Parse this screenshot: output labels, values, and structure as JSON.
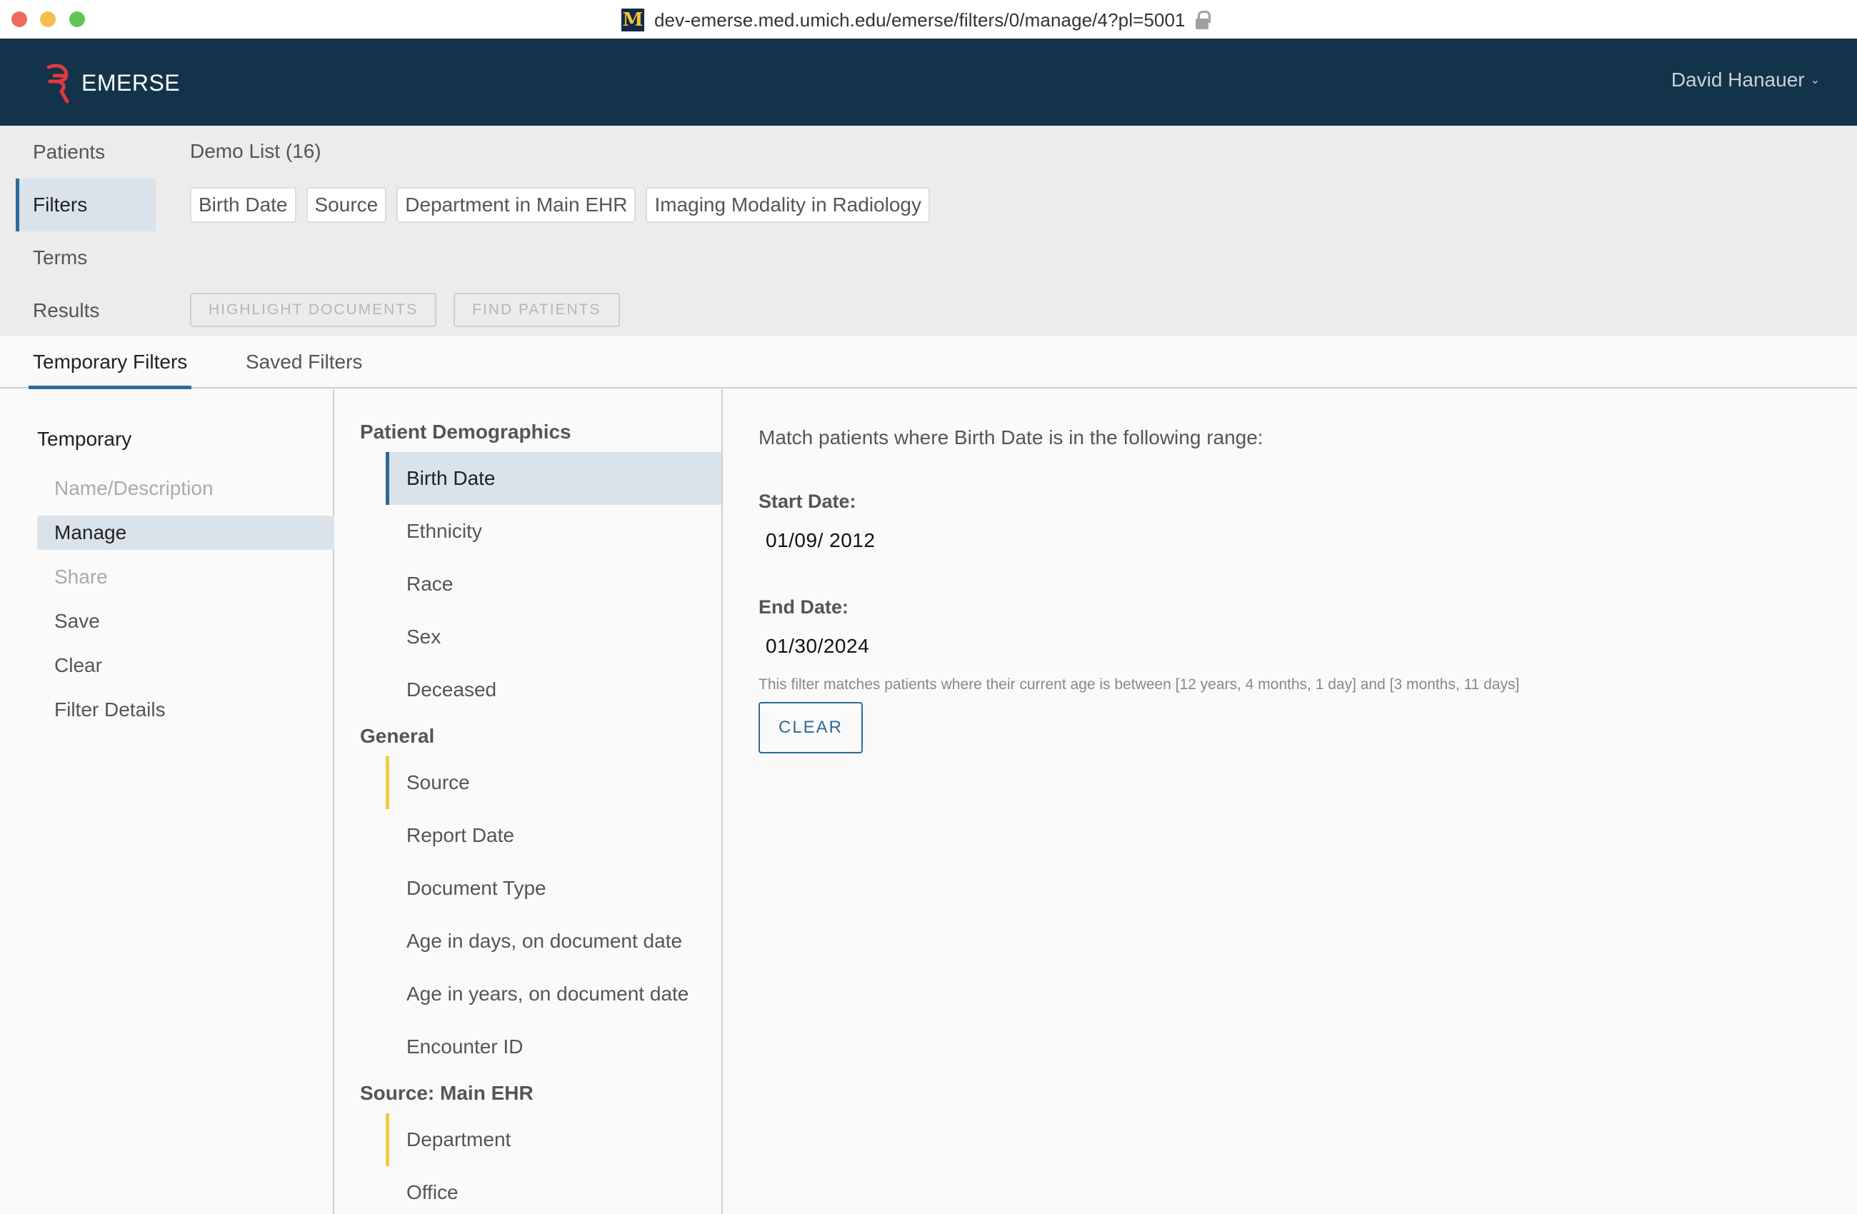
{
  "browser": {
    "url": "dev-emerse.med.umich.edu/emerse/filters/0/manage/4?pl=5001",
    "favicon_letter": "M"
  },
  "header": {
    "brand": "EMERSE",
    "user_name": "David Hanauer",
    "user_chevron": "⌄"
  },
  "main_nav": {
    "items": [
      {
        "label": "Patients"
      },
      {
        "label": "Filters",
        "active": true
      },
      {
        "label": "Terms"
      },
      {
        "label": "Results"
      }
    ]
  },
  "patient_list": {
    "label": "Demo List (16)"
  },
  "active_filters": {
    "tags": [
      "Birth Date",
      "Source",
      "Department in Main EHR",
      "Imaging Modality in Radiology"
    ]
  },
  "results_actions": {
    "highlight_label": "HIGHLIGHT DOCUMENTS",
    "find_label": "FIND PATIENTS"
  },
  "tabs": [
    {
      "label": "Temporary Filters",
      "active": true
    },
    {
      "label": "Saved Filters"
    }
  ],
  "left_nav": {
    "title": "Temporary",
    "items": [
      {
        "label": "Name/Description",
        "state": "disabled"
      },
      {
        "label": "Manage",
        "state": "active"
      },
      {
        "label": "Share",
        "state": "disabled"
      },
      {
        "label": "Save",
        "state": "normal"
      },
      {
        "label": "Clear",
        "state": "normal"
      },
      {
        "label": "Filter Details",
        "state": "normal"
      }
    ]
  },
  "filter_groups": [
    {
      "title": "Patient Demographics",
      "fields": [
        {
          "label": "Birth Date",
          "state": "active"
        },
        {
          "label": "Ethnicity",
          "state": "normal"
        },
        {
          "label": "Race",
          "state": "normal"
        },
        {
          "label": "Sex",
          "state": "normal"
        },
        {
          "label": "Deceased",
          "state": "normal"
        }
      ]
    },
    {
      "title": "General",
      "fields": [
        {
          "label": "Source",
          "state": "applied"
        },
        {
          "label": "Report Date",
          "state": "normal"
        },
        {
          "label": "Document Type",
          "state": "normal"
        },
        {
          "label": "Age in days, on document date",
          "state": "normal"
        },
        {
          "label": "Age in years, on document date",
          "state": "normal"
        },
        {
          "label": "Encounter ID",
          "state": "normal"
        }
      ]
    },
    {
      "title": "Source: Main EHR",
      "fields": [
        {
          "label": "Department",
          "state": "applied"
        },
        {
          "label": "Office",
          "state": "normal"
        }
      ]
    }
  ],
  "detail": {
    "description": "Match patients where Birth Date is in the following range:",
    "start_label": "Start Date:",
    "start_value": "01/09/ 2012",
    "end_label": "End Date:",
    "end_value": "01/30/2024",
    "hint": "This filter matches patients where their current age is between [12 years, 4 months, 1 day] and [3 months, 11 days]",
    "clear_label": "CLEAR"
  },
  "colors": {
    "header_bg": "#13334a",
    "accent": "#2e6a97",
    "applied_marker": "#f4c842",
    "selected_bg": "#dbe3ea",
    "logo_red": "#e0393e"
  }
}
